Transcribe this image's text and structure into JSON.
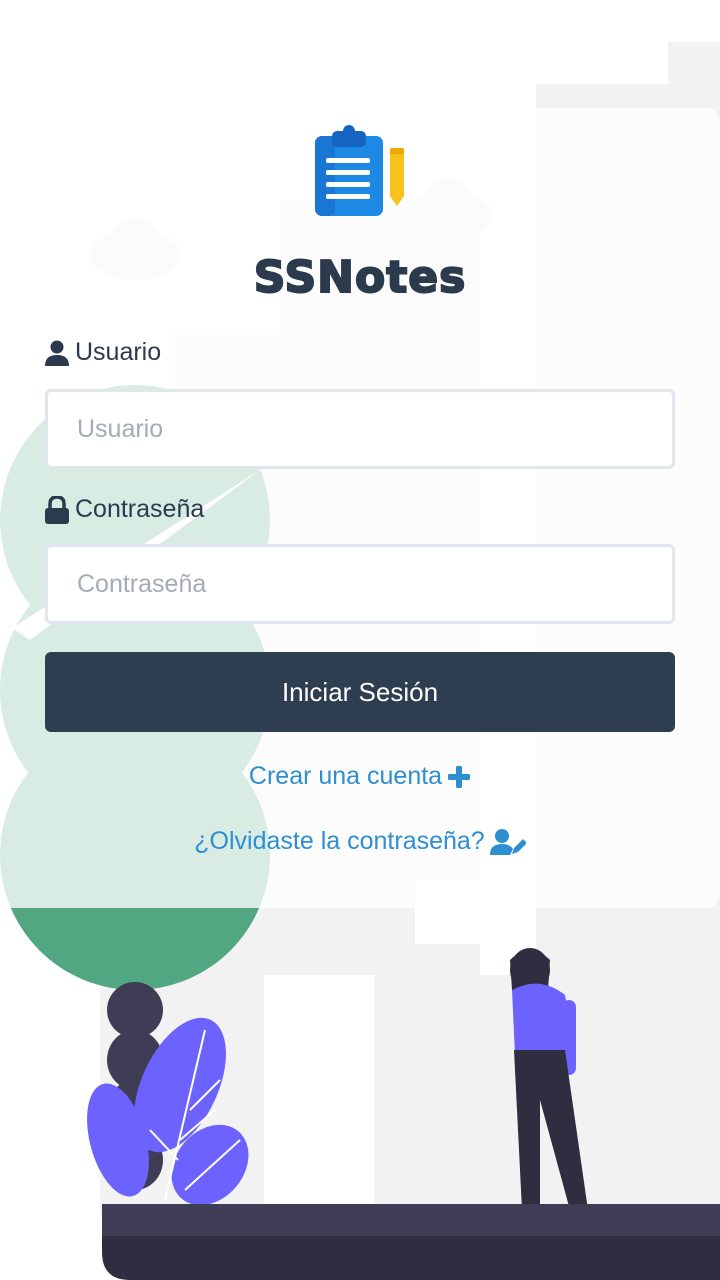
{
  "app": {
    "name": "SSNotes"
  },
  "login": {
    "username_label": "Usuario",
    "username_placeholder": "Usuario",
    "password_label": "Contraseña",
    "password_placeholder": "Contraseña",
    "submit_label": "Iniciar Sesión",
    "create_account_label": "Crear una cuenta",
    "forgot_password_label": "¿Olvidaste la contraseña?"
  },
  "colors": {
    "primary_dark": "#2e3d4f",
    "link_blue": "#2d8fd0",
    "logo_blue": "#1e88e5",
    "pencil_yellow": "#f9c21b",
    "tree_green": "#52a783",
    "person_purple": "#6c63ff"
  },
  "icons": {
    "logo": "clipboard-pencil-icon",
    "username": "user-icon",
    "password": "lock-icon",
    "create_account": "plus-icon",
    "forgot_password": "user-edit-icon"
  }
}
